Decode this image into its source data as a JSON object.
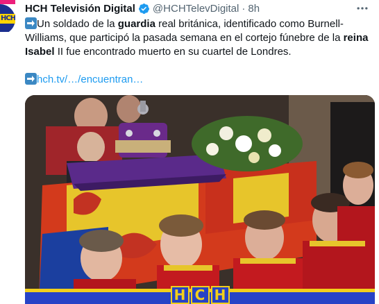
{
  "avatar": {
    "logo_text": "HCH"
  },
  "tweet": {
    "author_name": "HCH Televisión Digital",
    "handle": "@HCHTelevDigital",
    "separator": "·",
    "time": "8h",
    "body": {
      "t1": "Un soldado de la ",
      "b1": "guardia",
      "t2": " real británica, identificado como Burnell-Williams, que participó la pasada semana en el cortejo fúnebre de la ",
      "b2": "reina Isabel",
      "t3": " II fue encontrado muerto en su cuartel de Londres."
    },
    "link_text": "hch.tv/…/encuentran…"
  },
  "media": {
    "watermark": [
      "H",
      "C",
      "H"
    ]
  },
  "colors": {
    "link": "#1d9bf0",
    "verified": "#1d9bf0",
    "brand_blue": "#2743c6",
    "brand_yellow": "#f2cf1b"
  },
  "icons": {
    "verified": "verified-badge-icon",
    "more": "more-options-icon",
    "arrow": "right-arrow-emoji-icon"
  }
}
